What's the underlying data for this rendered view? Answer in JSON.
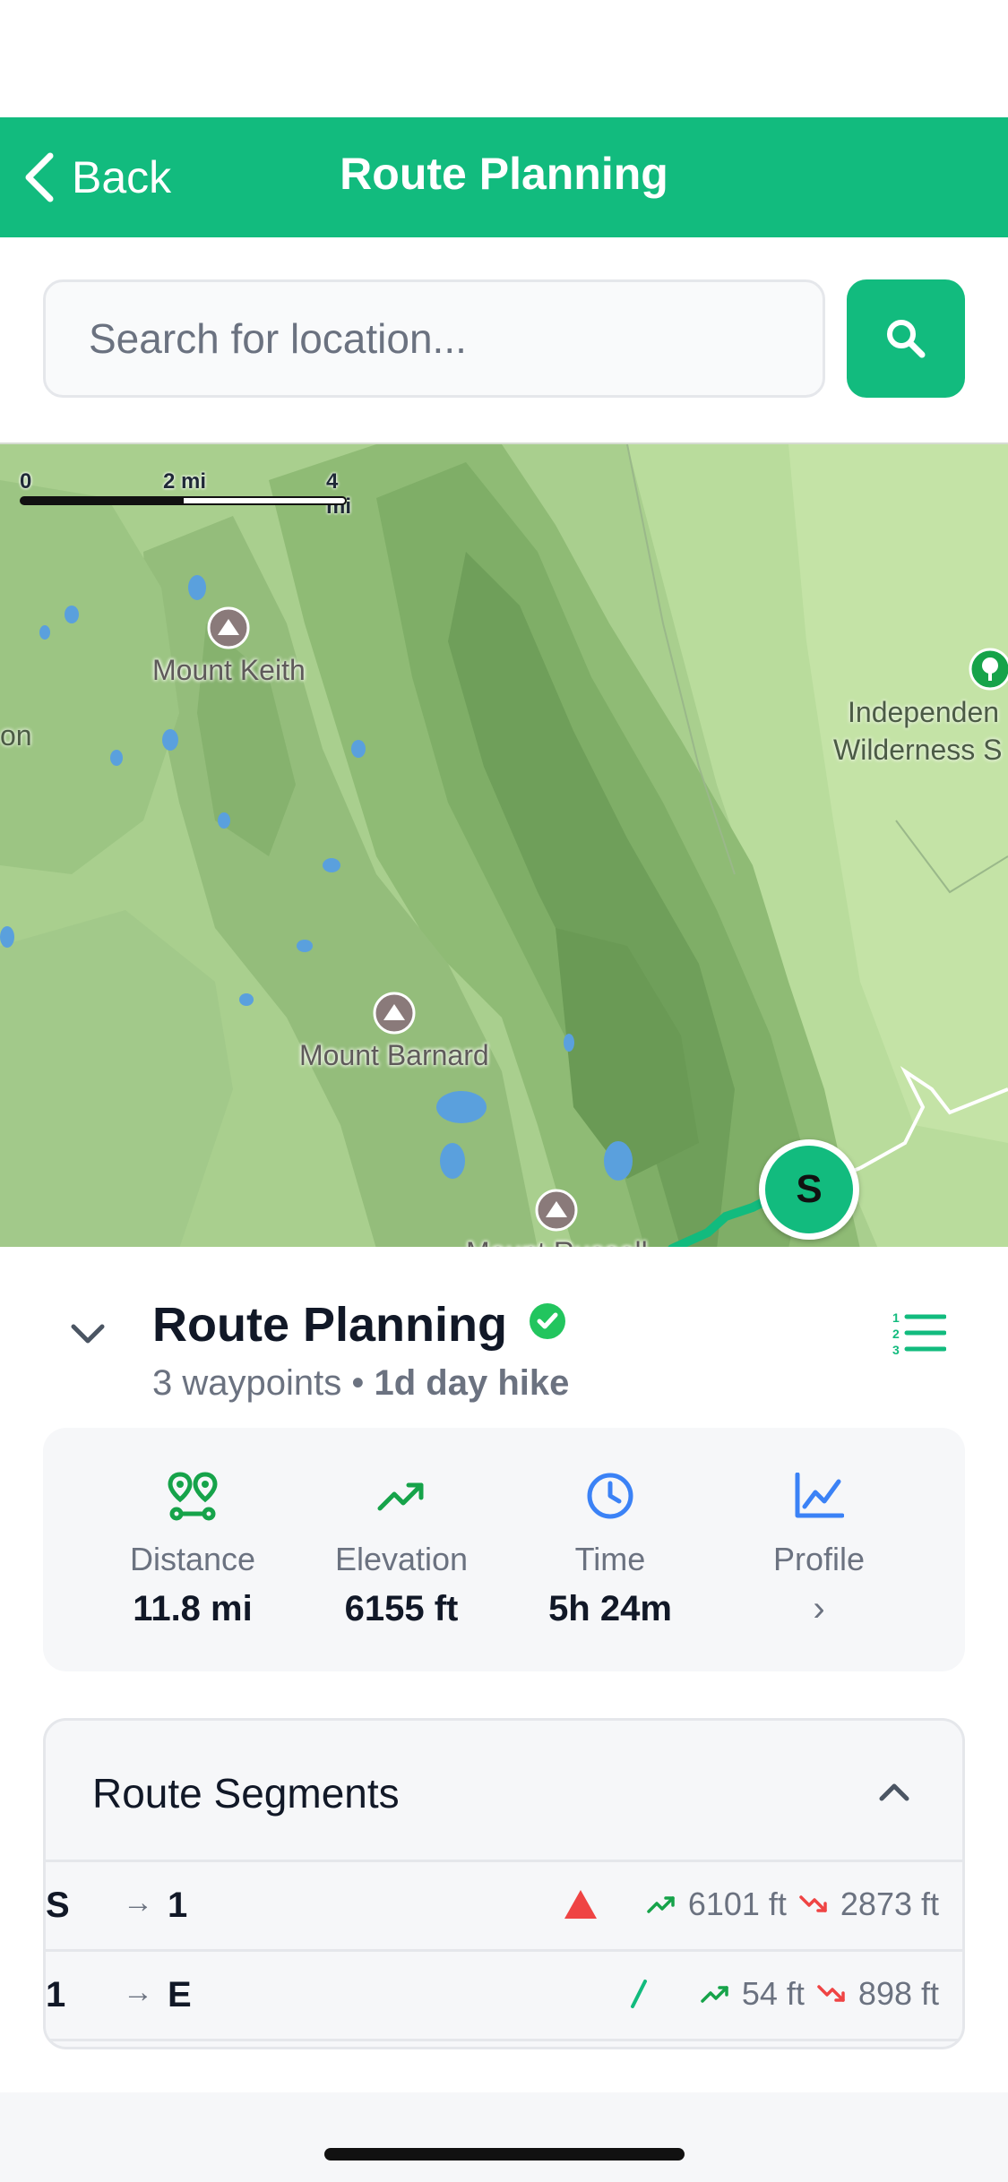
{
  "header": {
    "back_label": "Back",
    "title": "Route Planning"
  },
  "search": {
    "placeholder": "Search for location...",
    "value": ""
  },
  "map": {
    "scale_labels": [
      "0",
      "2 mi",
      "4 mi"
    ],
    "places": {
      "mount_keith": "Mount Keith",
      "mount_barnard": "Mount Barnard",
      "mount_partial": "Mount Russell",
      "independence_line1": "Independen",
      "independence_line2": "Wilderness S",
      "left_edge_partial": "on"
    },
    "start_marker": "S"
  },
  "route": {
    "title": "Route Planning",
    "waypoints": "3 waypoints",
    "separator": "•",
    "trip_type": "1d day hike",
    "stats": {
      "distance": {
        "label": "Distance",
        "value": "11.8 mi",
        "icon": "waypoints-icon"
      },
      "elevation": {
        "label": "Elevation",
        "value": "6155 ft",
        "icon": "trending-up-icon"
      },
      "time": {
        "label": "Time",
        "value": "5h 24m",
        "icon": "clock-icon"
      },
      "profile": {
        "label": "Profile",
        "chevron": "›",
        "icon": "line-chart-icon"
      }
    }
  },
  "segments": {
    "title": "Route Segments",
    "rows": [
      {
        "from": "S",
        "arrow": "→",
        "to": "1",
        "gain": "6101 ft",
        "loss": "2873 ft",
        "indicator": "steep-triangle-icon"
      },
      {
        "from": "1",
        "arrow": "→",
        "to": "E",
        "gain": "54 ft",
        "loss": "898 ft",
        "indicator": "gentle-slope-icon"
      }
    ]
  },
  "colors": {
    "brand": "#12bb7e",
    "gain": "#16a34a",
    "loss": "#ef4444",
    "blue": "#3b82f6"
  }
}
